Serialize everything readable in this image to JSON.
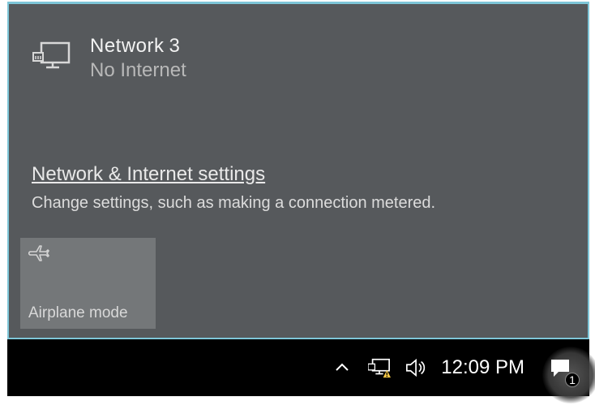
{
  "flyout": {
    "network": {
      "name": "Network",
      "index": "3",
      "status": "No Internet",
      "icon": "ethernet-monitor-icon"
    },
    "settings": {
      "link_label": "Network & Internet settings",
      "description": "Change settings, such as making a connection metered."
    },
    "tiles": [
      {
        "icon": "airplane-icon",
        "label": "Airplane mode"
      }
    ]
  },
  "taskbar": {
    "tray": {
      "overflow_icon": "chevron-up-icon",
      "network_icon": "ethernet-warning-icon",
      "volume_icon": "speaker-icon"
    },
    "clock": "12:09 PM",
    "action_center": {
      "icon": "action-center-icon",
      "badge_count": "1"
    }
  },
  "colors": {
    "flyout_bg": "#56595c",
    "flyout_border": "#7ec6d8",
    "tile_bg": "rgba(255,255,255,0.18)",
    "taskbar_bg": "#000000",
    "warning": "#f7c948"
  }
}
